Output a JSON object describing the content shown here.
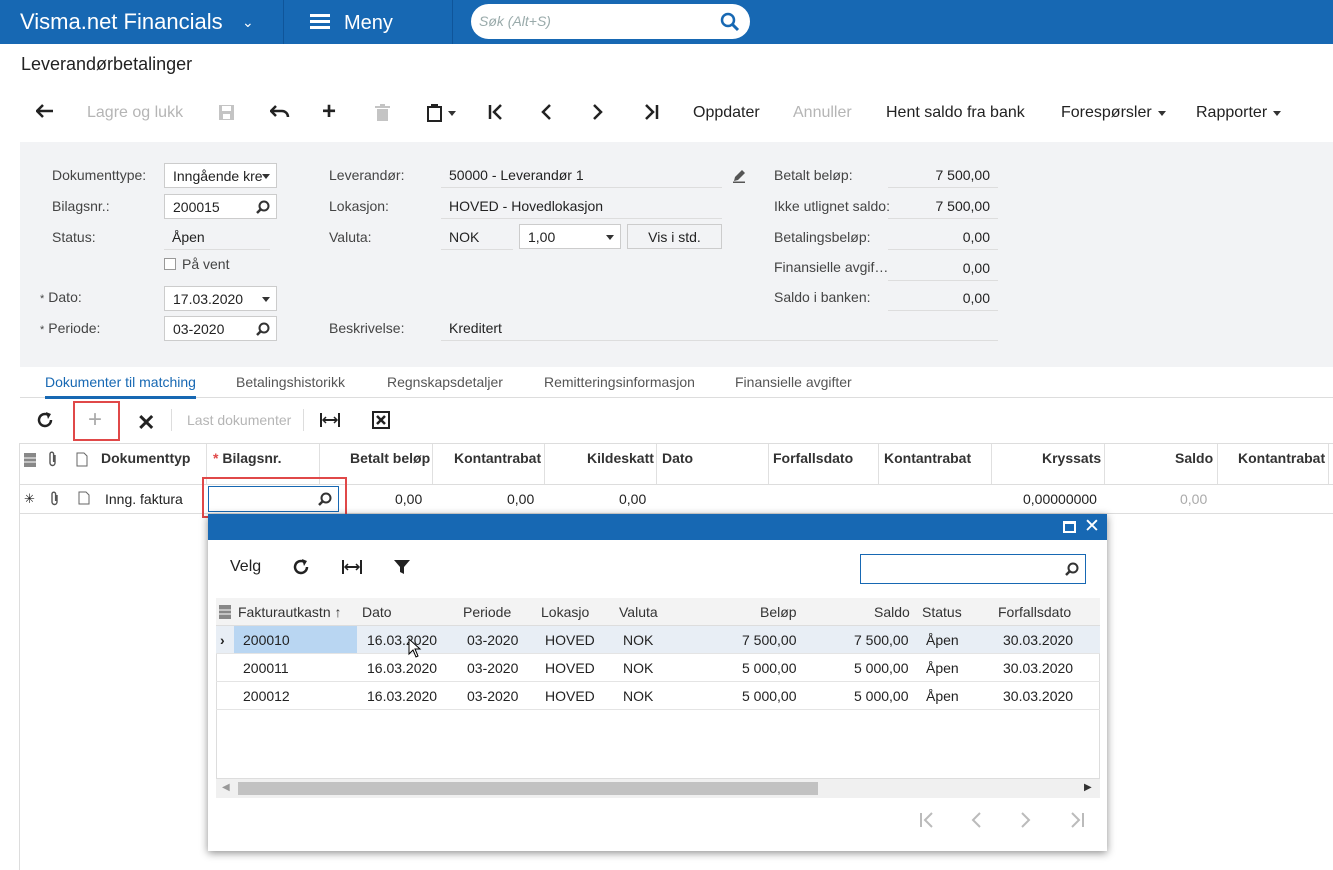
{
  "app": {
    "brand": "Visma.net Financials",
    "menu_label": "Meny",
    "search_placeholder": "Søk (Alt+S)"
  },
  "page_title": "Leverandørbetalinger",
  "toolbar": {
    "save_close": "Lagre og lukk",
    "refresh": "Oppdater",
    "cancel": "Annuller",
    "fetch_balance": "Hent saldo fra bank",
    "inquiries": "Forespørsler",
    "reports": "Rapporter"
  },
  "form": {
    "doc_type_label": "Dokumenttype:",
    "doc_type_value": "Inngående kre",
    "voucher_label": "Bilagsnr.:",
    "voucher_value": "200015",
    "status_label": "Status:",
    "status_value": "Åpen",
    "on_hold_label": "På vent",
    "date_label": "Dato:",
    "date_value": "17.03.2020",
    "period_label": "Periode:",
    "period_value": "03-2020",
    "supplier_label": "Leverandør:",
    "supplier_value": "50000 - Leverandør 1",
    "location_label": "Lokasjon:",
    "location_value": "HOVED - Hovedlokasjon",
    "currency_label": "Valuta:",
    "currency_value": "NOK",
    "rate_value": "1,00",
    "view_std": "Vis i std.",
    "desc_label": "Beskrivelse:",
    "desc_value": "Kreditert",
    "paid_label": "Betalt beløp:",
    "paid_value": "7 500,00",
    "unapplied_label": "Ikke utlignet saldo:",
    "unapplied_value": "7 500,00",
    "payment_label": "Betalingsbeløp:",
    "payment_value": "0,00",
    "fin_fees_label": "Finansielle avgif…",
    "fin_fees_value": "0,00",
    "bank_balance_label": "Saldo i banken:",
    "bank_balance_value": "0,00"
  },
  "tabs": [
    "Dokumenter til matching",
    "Betalingshistorikk",
    "Regnskapsdetaljer",
    "Remitteringsinformasjon",
    "Finansielle avgifter"
  ],
  "grid": {
    "load_docs": "Last dokumenter",
    "headers": [
      "Dokumenttyp",
      "Bilagsnr.",
      "Betalt beløp",
      "Kontantrabat",
      "Kildeskatt",
      "Dato",
      "Forfallsdato",
      "Kontantrabat",
      "Kryssats",
      "Saldo",
      "Kontantrabat"
    ],
    "row": {
      "doc_type": "Inng. faktura",
      "paid": "0,00",
      "discount": "0,00",
      "withholding": "0,00",
      "cross_rate": "0,00000000",
      "balance": "0,00"
    }
  },
  "popup": {
    "select_label": "Velg",
    "headers": [
      "Fakturautkastn",
      "Dato",
      "Periode",
      "Lokasjo",
      "Valuta",
      "Beløp",
      "Saldo",
      "Status",
      "Forfallsdato"
    ],
    "rows": [
      [
        "200010",
        "16.03.2020",
        "03-2020",
        "HOVED",
        "NOK",
        "7 500,00",
        "7 500,00",
        "Åpen",
        "30.03.2020"
      ],
      [
        "200011",
        "16.03.2020",
        "03-2020",
        "HOVED",
        "NOK",
        "5 000,00",
        "5 000,00",
        "Åpen",
        "30.03.2020"
      ],
      [
        "200012",
        "16.03.2020",
        "03-2020",
        "HOVED",
        "NOK",
        "5 000,00",
        "5 000,00",
        "Åpen",
        "30.03.2020"
      ]
    ]
  },
  "colors": {
    "brand_blue": "#1768b3",
    "highlight_red": "#e04848"
  }
}
